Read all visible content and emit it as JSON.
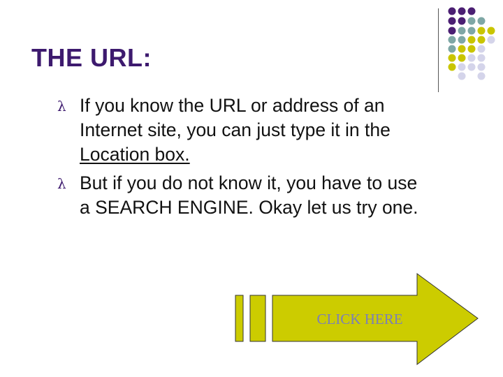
{
  "slide": {
    "title": "THE URL:",
    "bullets": [
      {
        "symbol": "λ",
        "lines": [
          "If you know the URL or address of an",
          "Internet site, you can just type it in the",
          "Location box."
        ]
      },
      {
        "symbol": "λ",
        "lines": [
          "But if you do not know it, you have to use",
          "a SEARCH ENGINE.  Okay let us try one."
        ]
      }
    ],
    "action_button": {
      "label": "CLICK HERE",
      "icon": "right-arrow-icon"
    }
  },
  "colors": {
    "title": "#3d1a6e",
    "dot_purple": "#4b1f73",
    "dot_teal": "#7ea7a5",
    "dot_olive": "#c9c500",
    "dot_lavender": "#d4d4ea",
    "arrow_fill": "#cccc00",
    "button_label": "#7b7fb8"
  }
}
